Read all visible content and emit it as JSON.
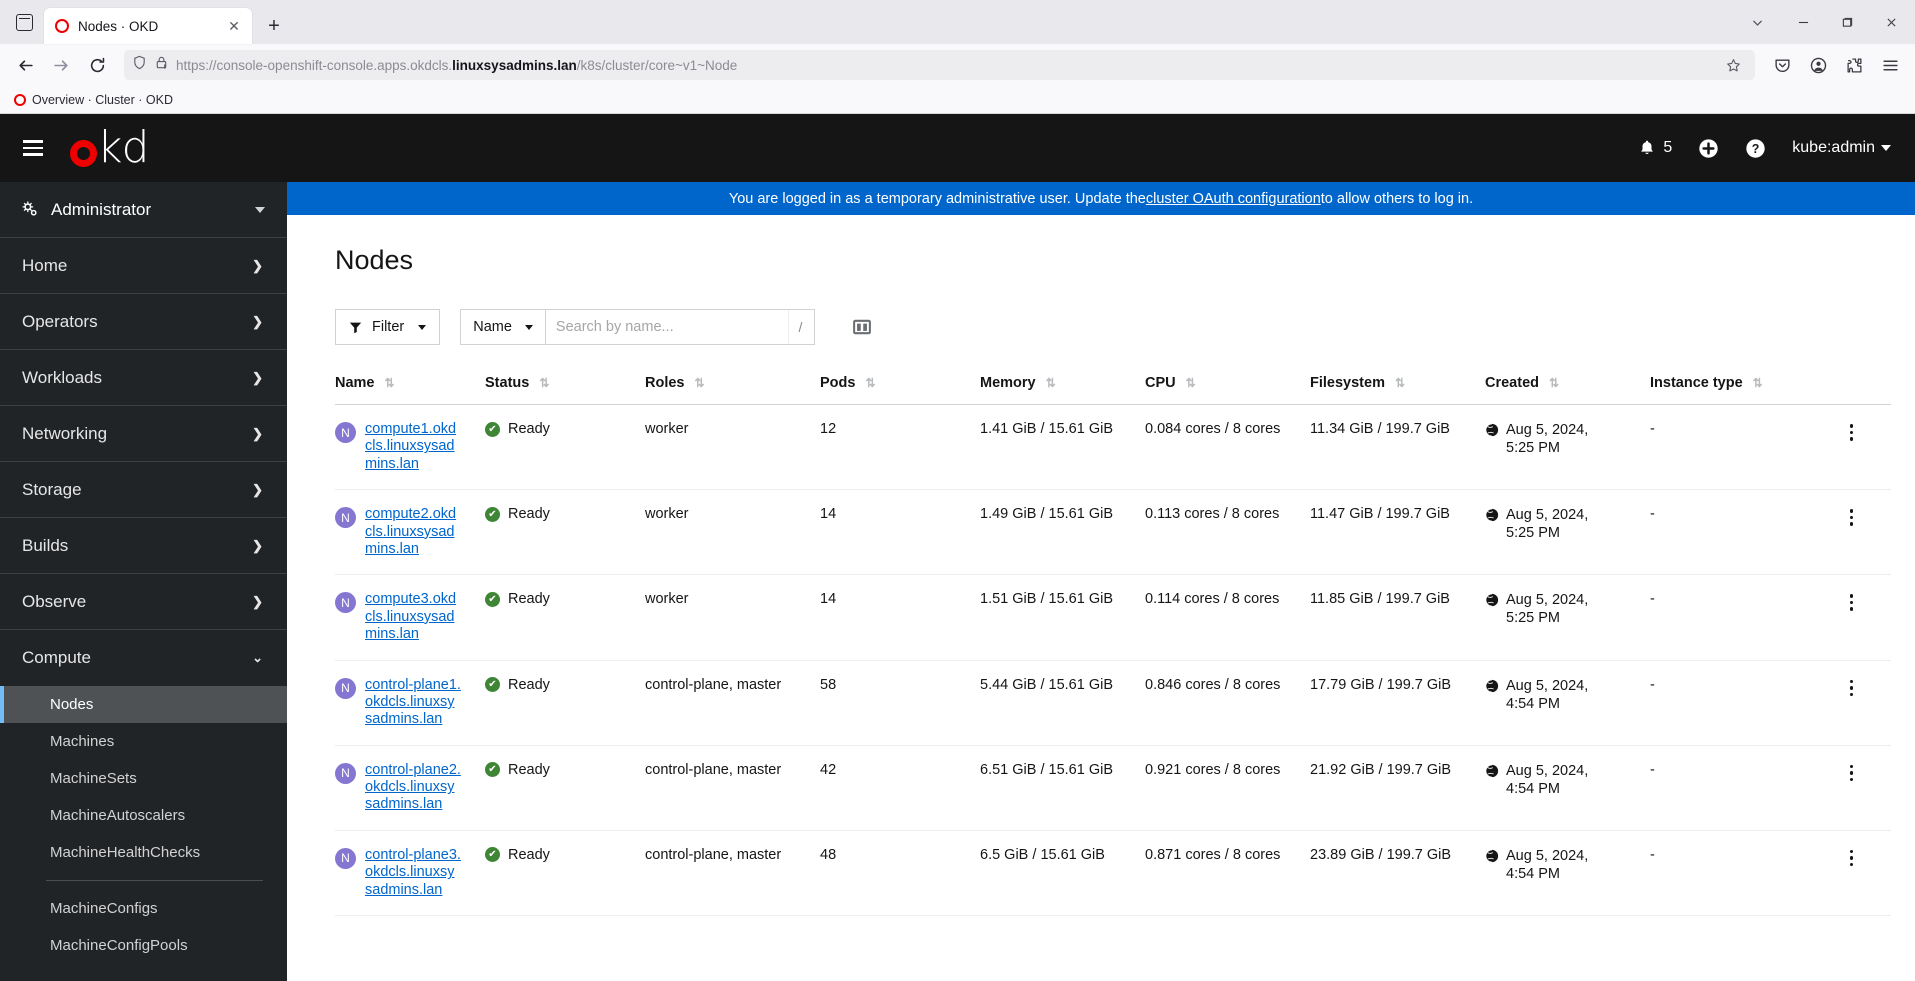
{
  "browser": {
    "tab": {
      "title": "Nodes · OKD",
      "favicon": "okd-ring-icon",
      "close_label": "✕"
    },
    "new_tab_label": "+",
    "url": {
      "prefix": "https://console-openshift-console.apps.okdcls.",
      "host_bold": "linuxsysadmins.lan",
      "path": "/k8s/cluster/core~v1~Node"
    },
    "bookmark": {
      "label": "Overview · Cluster · OKD"
    },
    "window_controls": {
      "minimize": "—",
      "maximize": "❐",
      "close": "✕",
      "list_all_tabs": "⌄"
    }
  },
  "masthead": {
    "logo_text": "kd",
    "notifications_count": "5",
    "username": "kube:admin"
  },
  "banner": {
    "text_before": "You are logged in as a temporary administrative user. Update the ",
    "link": "cluster OAuth configuration",
    "text_after": " to allow others to log in."
  },
  "sidebar": {
    "perspective": "Administrator",
    "items": [
      {
        "label": "Home"
      },
      {
        "label": "Operators"
      },
      {
        "label": "Workloads"
      },
      {
        "label": "Networking"
      },
      {
        "label": "Storage"
      },
      {
        "label": "Builds"
      },
      {
        "label": "Observe"
      },
      {
        "label": "Compute"
      }
    ],
    "compute_children": [
      {
        "label": "Nodes",
        "active": true
      },
      {
        "label": "Machines",
        "active": false
      },
      {
        "label": "MachineSets",
        "active": false
      },
      {
        "label": "MachineAutoscalers",
        "active": false
      },
      {
        "label": "MachineHealthChecks",
        "active": false
      }
    ],
    "compute_children_2": [
      {
        "label": "MachineConfigs"
      },
      {
        "label": "MachineConfigPools"
      }
    ]
  },
  "page": {
    "title": "Nodes",
    "toolbar": {
      "filter_label": "Filter",
      "name_select_label": "Name",
      "search_placeholder": "Search by name...",
      "search_value": "",
      "shortcut_key": "/"
    },
    "table": {
      "columns": [
        "Name",
        "Status",
        "Roles",
        "Pods",
        "Memory",
        "CPU",
        "Filesystem",
        "Created",
        "Instance type"
      ],
      "rows": [
        {
          "name": "compute1.okdcls.linuxsysadmins.lan",
          "status": "Ready",
          "roles": "worker",
          "pods": "12",
          "memory": "1.41 GiB / 15.61 GiB",
          "cpu": "0.084 cores / 8 cores",
          "filesystem": "11.34 GiB / 199.7 GiB",
          "created": "Aug 5, 2024, 5:25 PM",
          "instance_type": "-"
        },
        {
          "name": "compute2.okdcls.linuxsysadmins.lan",
          "status": "Ready",
          "roles": "worker",
          "pods": "14",
          "memory": "1.49 GiB / 15.61 GiB",
          "cpu": "0.113 cores / 8 cores",
          "filesystem": "11.47 GiB / 199.7 GiB",
          "created": "Aug 5, 2024, 5:25 PM",
          "instance_type": "-"
        },
        {
          "name": "compute3.okdcls.linuxsysadmins.lan",
          "status": "Ready",
          "roles": "worker",
          "pods": "14",
          "memory": "1.51 GiB / 15.61 GiB",
          "cpu": "0.114 cores / 8 cores",
          "filesystem": "11.85 GiB / 199.7 GiB",
          "created": "Aug 5, 2024, 5:25 PM",
          "instance_type": "-"
        },
        {
          "name": "control-plane1.okdcls.linuxsysadmins.lan",
          "status": "Ready",
          "roles": "control-plane, master",
          "pods": "58",
          "memory": "5.44 GiB / 15.61 GiB",
          "cpu": "0.846 cores / 8 cores",
          "filesystem": "17.79 GiB / 199.7 GiB",
          "created": "Aug 5, 2024, 4:54 PM",
          "instance_type": "-"
        },
        {
          "name": "control-plane2.okdcls.linuxsysadmins.lan",
          "status": "Ready",
          "roles": "control-plane, master",
          "pods": "42",
          "memory": "6.51 GiB / 15.61 GiB",
          "cpu": "0.921 cores / 8 cores",
          "filesystem": "21.92 GiB / 199.7 GiB",
          "created": "Aug 5, 2024, 4:54 PM",
          "instance_type": "-"
        },
        {
          "name": "control-plane3.okdcls.linuxsysadmins.lan",
          "status": "Ready",
          "roles": "control-plane, master",
          "pods": "48",
          "memory": "6.5 GiB / 15.61 GiB",
          "cpu": "0.871 cores / 8 cores",
          "filesystem": "23.89 GiB / 199.7 GiB",
          "created": "Aug 5, 2024, 4:54 PM",
          "instance_type": "-"
        }
      ],
      "resource_badge": "N"
    }
  },
  "colors": {
    "brand_red": "#e00000",
    "link_blue": "#0066cc",
    "banner_blue": "#0066cc",
    "status_green": "#3e8635",
    "masthead_black": "#151515",
    "sidebar_dark": "#212427",
    "badge_purple": "#8476d1"
  }
}
